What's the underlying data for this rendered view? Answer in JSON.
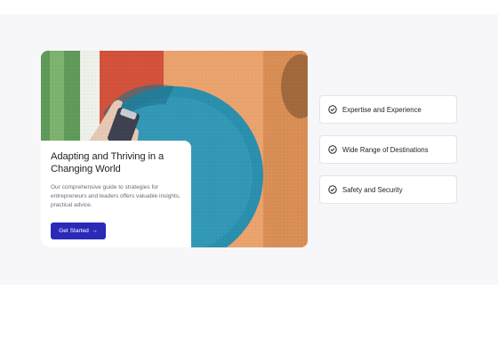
{
  "card": {
    "title": "Adapting and Thriving in a Changing World",
    "description": "Our comprehensive guide to strategies for entrepreneurs and leaders offers valuable insights, practical advice.",
    "cta_label": "Get Started",
    "cta_icon": "arrow-right-icon"
  },
  "features": [
    {
      "label": "Expertise and Experience",
      "icon": "check-circle-icon"
    },
    {
      "label": "Wide Range of Destinations",
      "icon": "check-circle-icon"
    },
    {
      "label": "Safety and Security",
      "icon": "check-circle-icon"
    }
  ],
  "colors": {
    "accent": "#2a29b8",
    "band_background": "#f7f7f9",
    "mural_orange": "#e8995a",
    "mural_blue": "#2a8fae",
    "mural_red": "#d4513a"
  }
}
